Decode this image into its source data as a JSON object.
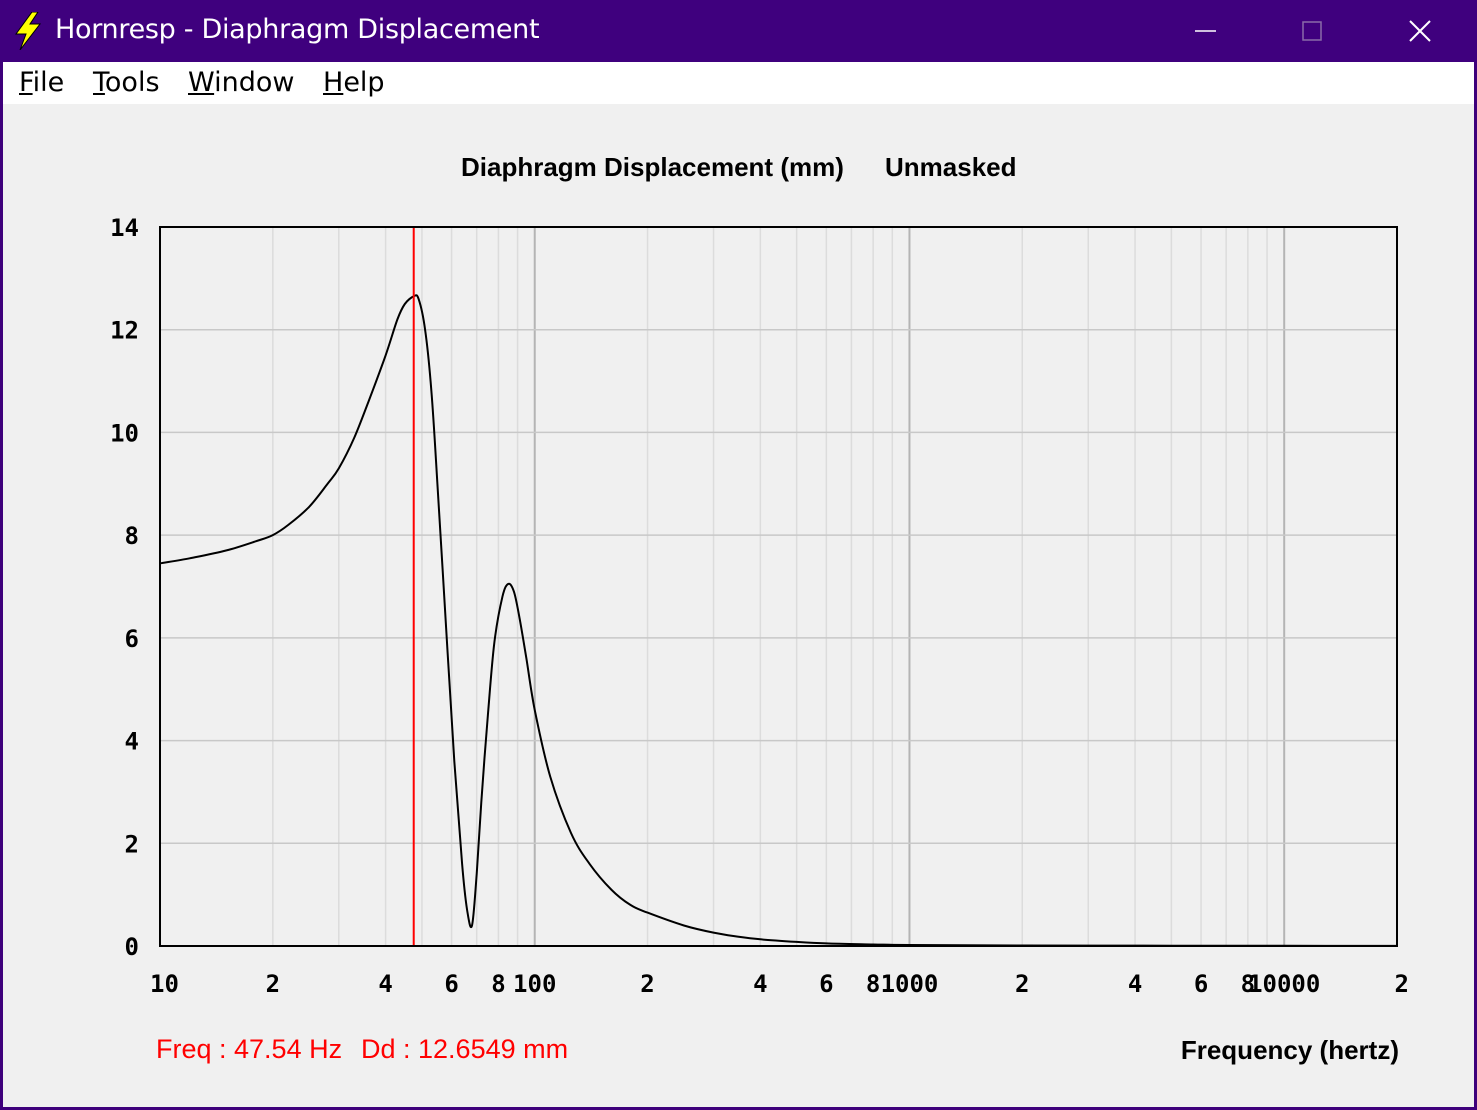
{
  "window": {
    "title": "Hornresp - Diaphragm Displacement",
    "icon": "lightning-bolt-icon",
    "controls": [
      "minimize-icon",
      "maximize-icon",
      "close-icon"
    ]
  },
  "menu": {
    "items": [
      {
        "label": "File",
        "accel": "F",
        "rest": "ile"
      },
      {
        "label": "Tools",
        "accel": "T",
        "rest": "ools"
      },
      {
        "label": "Window",
        "accel": "W",
        "rest": "indow"
      },
      {
        "label": "Help",
        "accel": "H",
        "rest": "elp"
      }
    ]
  },
  "readout": {
    "freq": "Freq : 47.54 Hz",
    "dd": "Dd : 12.6549 mm"
  },
  "colors": {
    "titlebar": "#3f007e",
    "cursor": "#ff0000",
    "curve": "#000000",
    "grid": "#c8c8c8",
    "background": "#f0f0f0"
  },
  "chart_data": {
    "type": "line",
    "title": "Diaphragm Displacement (mm)",
    "subtitle": "Unmasked",
    "xlabel": "Frequency (hertz)",
    "ylabel": "",
    "x_scale": "log",
    "xlim": [
      10,
      20000
    ],
    "ylim": [
      0,
      14
    ],
    "grid": true,
    "yticks": [
      "0",
      "2",
      "4",
      "6",
      "8",
      "10",
      "12",
      "14"
    ],
    "xticks": [
      {
        "value": 10,
        "label": "10"
      },
      {
        "value": 20,
        "label": "2"
      },
      {
        "value": 40,
        "label": "4"
      },
      {
        "value": 60,
        "label": "6"
      },
      {
        "value": 80,
        "label": "8"
      },
      {
        "value": 100,
        "label": "100"
      },
      {
        "value": 200,
        "label": "2"
      },
      {
        "value": 400,
        "label": "4"
      },
      {
        "value": 600,
        "label": "6"
      },
      {
        "value": 800,
        "label": "8"
      },
      {
        "value": 1000,
        "label": "1000"
      },
      {
        "value": 2000,
        "label": "2"
      },
      {
        "value": 4000,
        "label": "4"
      },
      {
        "value": 6000,
        "label": "6"
      },
      {
        "value": 8000,
        "label": "8"
      },
      {
        "value": 10000,
        "label": "10000"
      },
      {
        "value": 20000,
        "label": "2"
      }
    ],
    "cursor_x": 47.54,
    "series": [
      {
        "x": [
          10,
          12,
          15,
          18,
          20,
          22,
          25,
          28,
          30,
          33,
          36,
          40,
          43,
          45,
          47.54,
          49,
          51,
          53,
          55,
          58,
          61,
          64,
          66,
          68,
          70,
          72,
          75,
          78,
          82,
          85,
          88,
          91,
          95,
          100,
          110,
          125,
          140,
          160,
          180,
          200,
          250,
          300,
          350,
          400,
          500,
          600,
          800,
          1000,
          2000,
          5000,
          10000,
          20000
        ],
        "y": [
          7.45,
          7.55,
          7.7,
          7.88,
          8.0,
          8.2,
          8.55,
          9.0,
          9.3,
          9.9,
          10.6,
          11.5,
          12.2,
          12.5,
          12.65,
          12.6,
          12.0,
          10.8,
          9.0,
          6.2,
          3.6,
          1.6,
          0.7,
          0.4,
          1.4,
          2.8,
          4.5,
          5.9,
          6.8,
          7.05,
          6.9,
          6.4,
          5.6,
          4.6,
          3.3,
          2.2,
          1.6,
          1.1,
          0.8,
          0.65,
          0.4,
          0.26,
          0.18,
          0.13,
          0.08,
          0.05,
          0.03,
          0.02,
          0.01,
          0.005,
          0.003,
          0.002
        ]
      }
    ]
  }
}
